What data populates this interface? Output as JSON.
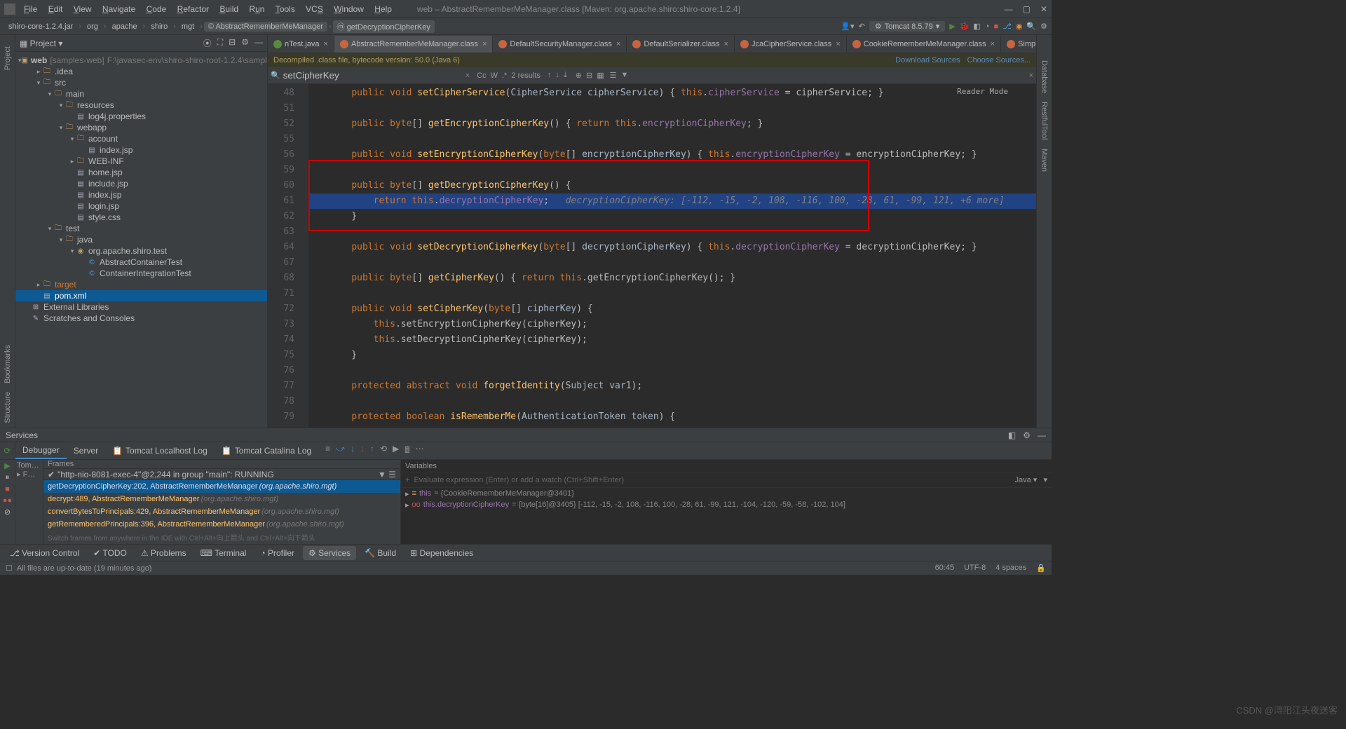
{
  "menu": {
    "file": "File",
    "edit": "Edit",
    "view": "View",
    "navigate": "Navigate",
    "code": "Code",
    "refactor": "Refactor",
    "build": "Build",
    "run": "Run",
    "tools": "Tools",
    "vcs": "VCS",
    "window": "Window",
    "help": "Help"
  },
  "title": "web – AbstractRememberMeManager.class [Maven: org.apache.shiro:shiro-core:1.2.4]",
  "breadcrumb": [
    "shiro-core-1.2.4.jar",
    "org",
    "apache",
    "shiro",
    "mgt",
    "AbstractRememberMeManager",
    "getDecryptionCipherKey"
  ],
  "runconfig": "Tomcat 8.5.79",
  "project": {
    "title": "Project",
    "root": {
      "name": "web",
      "extra": "[samples-web]",
      "path": "F:\\javasec-env\\shiro-shiro-root-1.2.4\\samples\\web"
    },
    "items": [
      {
        "d": 1,
        "i": "folder",
        "n": ".idea"
      },
      {
        "d": 1,
        "i": "folder",
        "n": "src",
        "exp": true
      },
      {
        "d": 2,
        "i": "folder",
        "n": "main",
        "exp": true
      },
      {
        "d": 3,
        "i": "folder",
        "n": "resources",
        "exp": true
      },
      {
        "d": 4,
        "i": "file",
        "n": "log4j.properties"
      },
      {
        "d": 3,
        "i": "folder",
        "n": "webapp",
        "exp": true
      },
      {
        "d": 4,
        "i": "folder",
        "n": "account",
        "exp": true
      },
      {
        "d": 5,
        "i": "file",
        "n": "index.jsp"
      },
      {
        "d": 4,
        "i": "folder",
        "n": "WEB-INF"
      },
      {
        "d": 4,
        "i": "file",
        "n": "home.jsp"
      },
      {
        "d": 4,
        "i": "file",
        "n": "include.jsp"
      },
      {
        "d": 4,
        "i": "file",
        "n": "index.jsp"
      },
      {
        "d": 4,
        "i": "file",
        "n": "login.jsp"
      },
      {
        "d": 4,
        "i": "file",
        "n": "style.css"
      },
      {
        "d": 2,
        "i": "folder",
        "n": "test",
        "exp": true
      },
      {
        "d": 3,
        "i": "folder",
        "n": "java",
        "exp": true
      },
      {
        "d": 4,
        "i": "pkg",
        "n": "org.apache.shiro.test",
        "exp": true
      },
      {
        "d": 5,
        "i": "java",
        "n": "AbstractContainerTest"
      },
      {
        "d": 5,
        "i": "java",
        "n": "ContainerIntegrationTest"
      },
      {
        "d": 1,
        "i": "folder",
        "n": "target",
        "orange": true
      },
      {
        "d": 1,
        "i": "file",
        "n": "pom.xml",
        "sel": true
      },
      {
        "d": 0,
        "i": "lib",
        "n": "External Libraries"
      },
      {
        "d": 0,
        "i": "scr",
        "n": "Scratches and Consoles"
      }
    ]
  },
  "tabs": [
    {
      "n": "nTest.java",
      "a": false,
      "c": "#5a8a3e"
    },
    {
      "n": "AbstractRememberMeManager.class",
      "a": true,
      "c": "#c7653e"
    },
    {
      "n": "DefaultSecurityManager.class",
      "a": false,
      "c": "#c7653e"
    },
    {
      "n": "DefaultSerializer.class",
      "a": false,
      "c": "#c7653e"
    },
    {
      "n": "JcaCipherService.class",
      "a": false,
      "c": "#c7653e"
    },
    {
      "n": "CookieRememberMeManager.class",
      "a": false,
      "c": "#c7653e"
    },
    {
      "n": "SimpleCookie.class",
      "a": false,
      "c": "#c7653e"
    }
  ],
  "decomp": {
    "msg": "Decompiled .class file, bytecode version: 50.0 (Java 6)",
    "links": [
      "Download Sources",
      "Choose Sources..."
    ]
  },
  "search": {
    "q": "setCipherKey",
    "count": "2 results"
  },
  "reader": "Reader Mode",
  "lines": [
    48,
    51,
    52,
    55,
    56,
    59,
    60,
    61,
    62,
    63,
    64,
    67,
    68,
    71,
    72,
    73,
    74,
    75,
    76,
    77,
    78,
    79
  ],
  "hint61": "decryptionCipherKey: [-112, -15, -2, 108, -116, 100, -28, 61, -99, 121, +6 more]",
  "services": {
    "title": "Services"
  },
  "debug": {
    "tabs": [
      "Debugger",
      "Server",
      "Tomcat Localhost Log",
      "Tomcat Catalina Log"
    ],
    "subhead_left": "Tom…",
    "frames_hdr": "Frames",
    "vars_hdr": "Variables",
    "thread": "\"http-nio-8081-exec-4\"@2,244 in group \"main\": RUNNING",
    "frames": [
      {
        "f": "getDecryptionCipherKey:202, AbstractRememberMeManager",
        "c": "(org.apache.shiro.mgt)",
        "a": true
      },
      {
        "f": "decrypt:489, AbstractRememberMeManager",
        "c": "(org.apache.shiro.mgt)"
      },
      {
        "f": "convertBytesToPrincipals:429, AbstractRememberMeManager",
        "c": "(org.apache.shiro.mgt)"
      },
      {
        "f": "getRememberedPrincipals:396, AbstractRememberMeManager",
        "c": "(org.apache.shiro.mgt)"
      }
    ],
    "frames_note": "Switch frames from anywhere in the IDE with Ctrl+Alt+向上箭头 and Ctrl+Alt+向下箭头",
    "eval_placeholder": "Evaluate expression (Enter) or add a watch (Ctrl+Shift+Enter)",
    "lang": "Java",
    "vars": [
      {
        "k": "this",
        "v": "= {CookieRememberMeManager@3401}"
      },
      {
        "k": "this.decryptionCipherKey",
        "v": "= {byte[16]@3405} [-112, -15, -2, 108, -116, 100, -28, 61, -99, 121, -104, -120, -59, -58, -102, 104]",
        "oo": true
      }
    ]
  },
  "bottom": {
    "tabs": [
      "Version Control",
      "TODO",
      "Problems",
      "Terminal",
      "Profiler",
      "Services",
      "Build",
      "Dependencies"
    ],
    "sel": "Services"
  },
  "status": {
    "msg": "All files are up-to-date (19 minutes ago)",
    "pos": "60:45",
    "enc": "UTF-8",
    "spaces": "4 spaces"
  },
  "watermark": "CSDN @浔阳江头夜送客"
}
